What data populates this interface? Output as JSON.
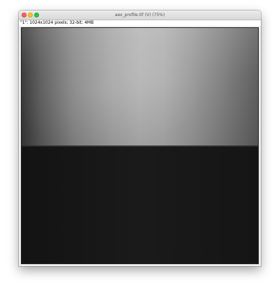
{
  "window": {
    "title": "aex_profile.tif (V) (75%)",
    "info": "\"1\"; 1024x1024 pixels; 32-bit; 4MB"
  },
  "controls": {
    "close": "close-button",
    "minimize": "minimize-button",
    "maximize": "maximize-button"
  },
  "image": {
    "upper_region": "bright gradient",
    "lower_region": "dark",
    "colors": {
      "upper_center": "#b6b6b6",
      "upper_left": "#3a3a3a",
      "lower": "#161616"
    }
  }
}
